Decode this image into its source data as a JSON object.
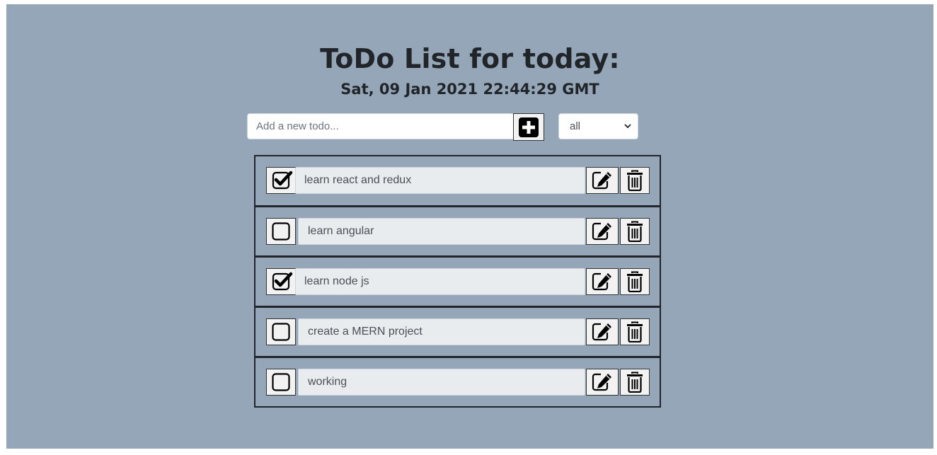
{
  "header": {
    "title": "ToDo List for today:",
    "datetime": "Sat, 09 Jan 2021 22:44:29 GMT"
  },
  "add_form": {
    "placeholder": "Add a new todo...",
    "value": "",
    "add_button_icon": "plus-square-icon"
  },
  "filter": {
    "selected": "all",
    "icon": "chevron-down-icon"
  },
  "todos": [
    {
      "text": "learn react and redux",
      "completed": true
    },
    {
      "text": "learn angular",
      "completed": false
    },
    {
      "text": "learn node js",
      "completed": true
    },
    {
      "text": "create a MERN project",
      "completed": false
    },
    {
      "text": "working",
      "completed": false
    }
  ],
  "icons": {
    "checked": "checked-box-icon",
    "unchecked": "empty-box-icon",
    "edit": "pencil-square-icon",
    "delete": "trash-icon"
  },
  "colors": {
    "background": "#94a6b8",
    "text": "#212529",
    "button_bg": "#f2f2f2",
    "field_bg": "#e9ecef"
  }
}
